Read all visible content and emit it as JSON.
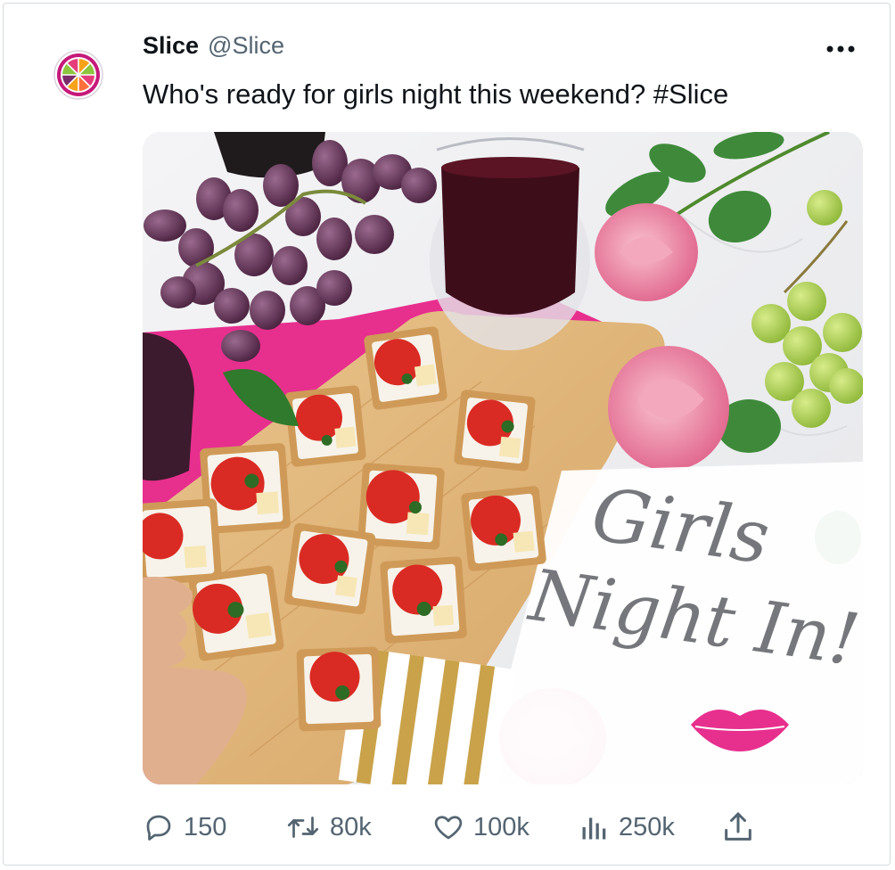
{
  "tweet": {
    "display_name": "Slice",
    "handle": "@Slice",
    "text": "Who's ready for girls night this weekend? #Slice",
    "media": {
      "sign_line1": "Girls",
      "sign_line2": "Night In!"
    }
  },
  "icons": {
    "avatar": "slice-logo",
    "more": "more-horizontal-icon",
    "reply": "reply-icon",
    "retweet": "retweet-icon",
    "like": "heart-icon",
    "views": "views-bar-chart-icon",
    "share": "share-icon"
  },
  "actions": {
    "replies": "150",
    "retweets": "80k",
    "likes": "100k",
    "views": "250k"
  },
  "colors": {
    "text_primary": "#0f1419",
    "text_secondary": "#536471",
    "border": "#d7dbdf"
  }
}
